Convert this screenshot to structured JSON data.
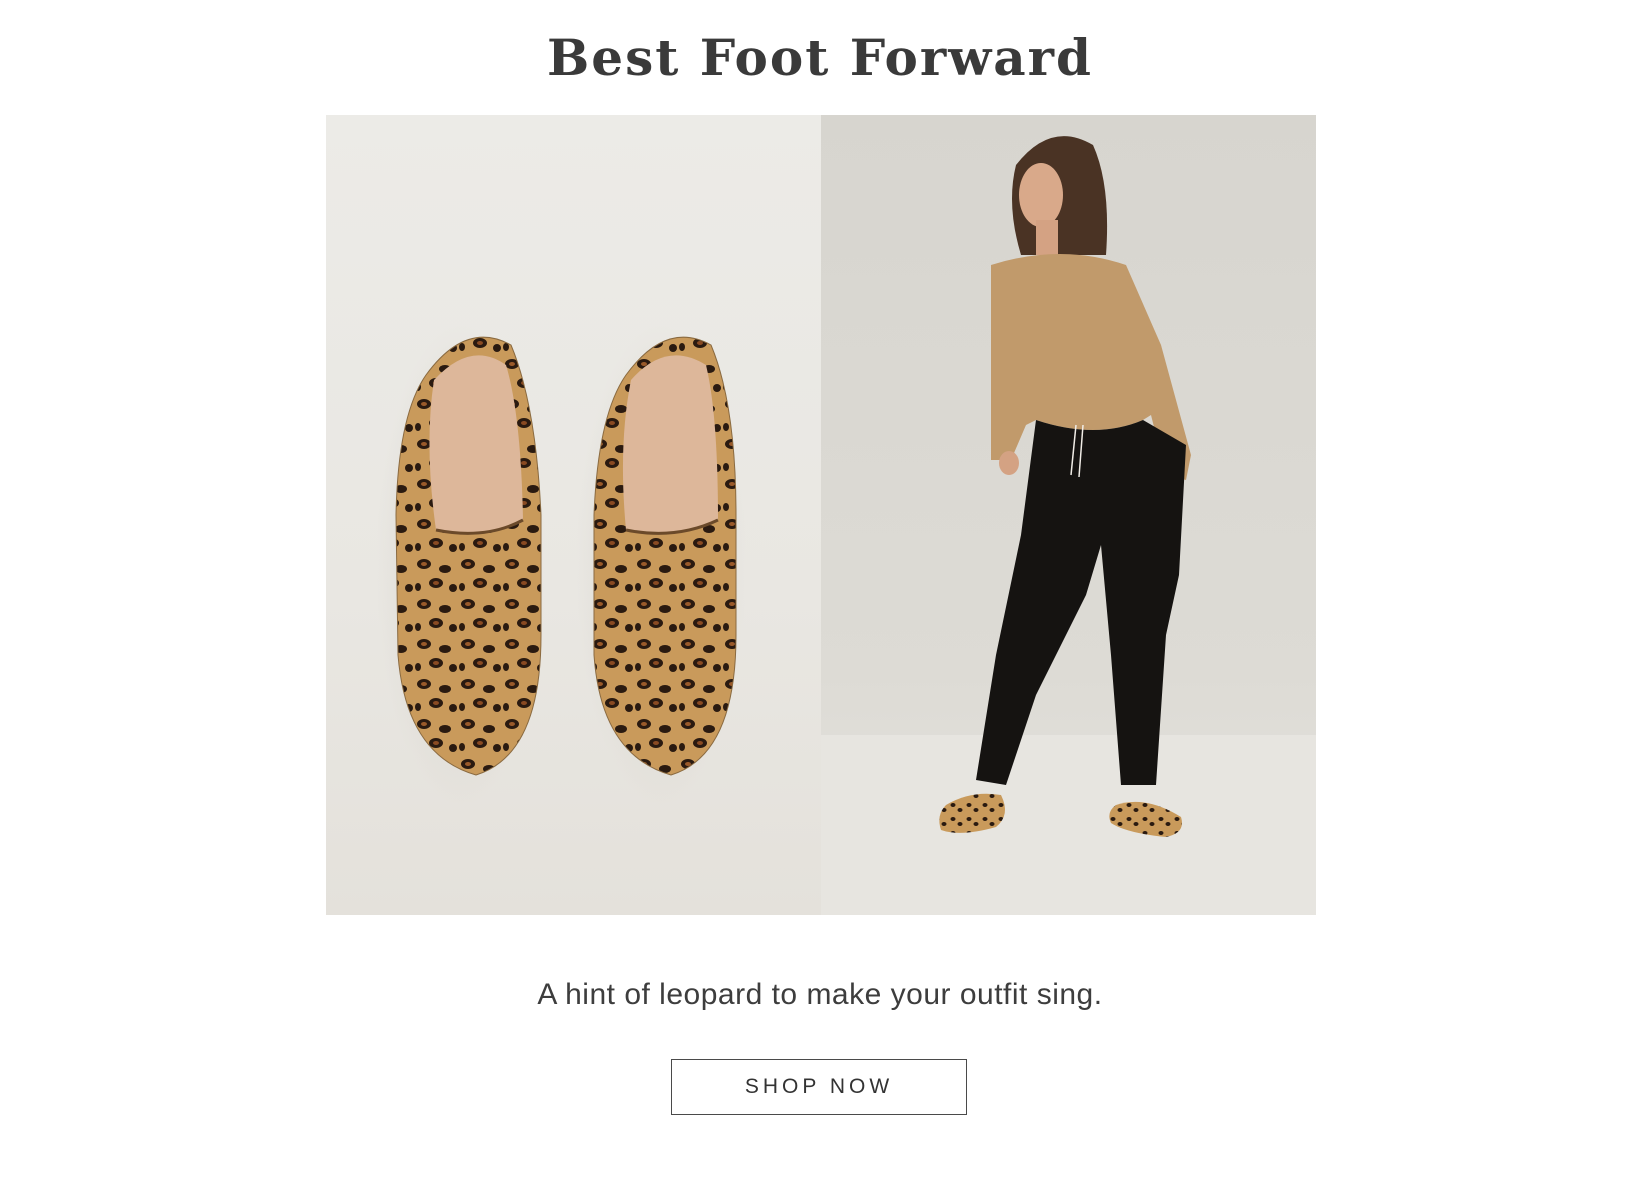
{
  "section": {
    "headline": "Best Foot Forward",
    "caption": "A hint of leopard to make your outfit sing.",
    "cta_label": "SHOP NOW"
  },
  "images": {
    "left": "leopard-loafers-flatlay-photo",
    "right": "model-sweater-black-trousers-leopard-loafers-photo"
  },
  "colors": {
    "text": "#333333",
    "button_border": "#4a4a4a",
    "background": "#ffffff"
  }
}
